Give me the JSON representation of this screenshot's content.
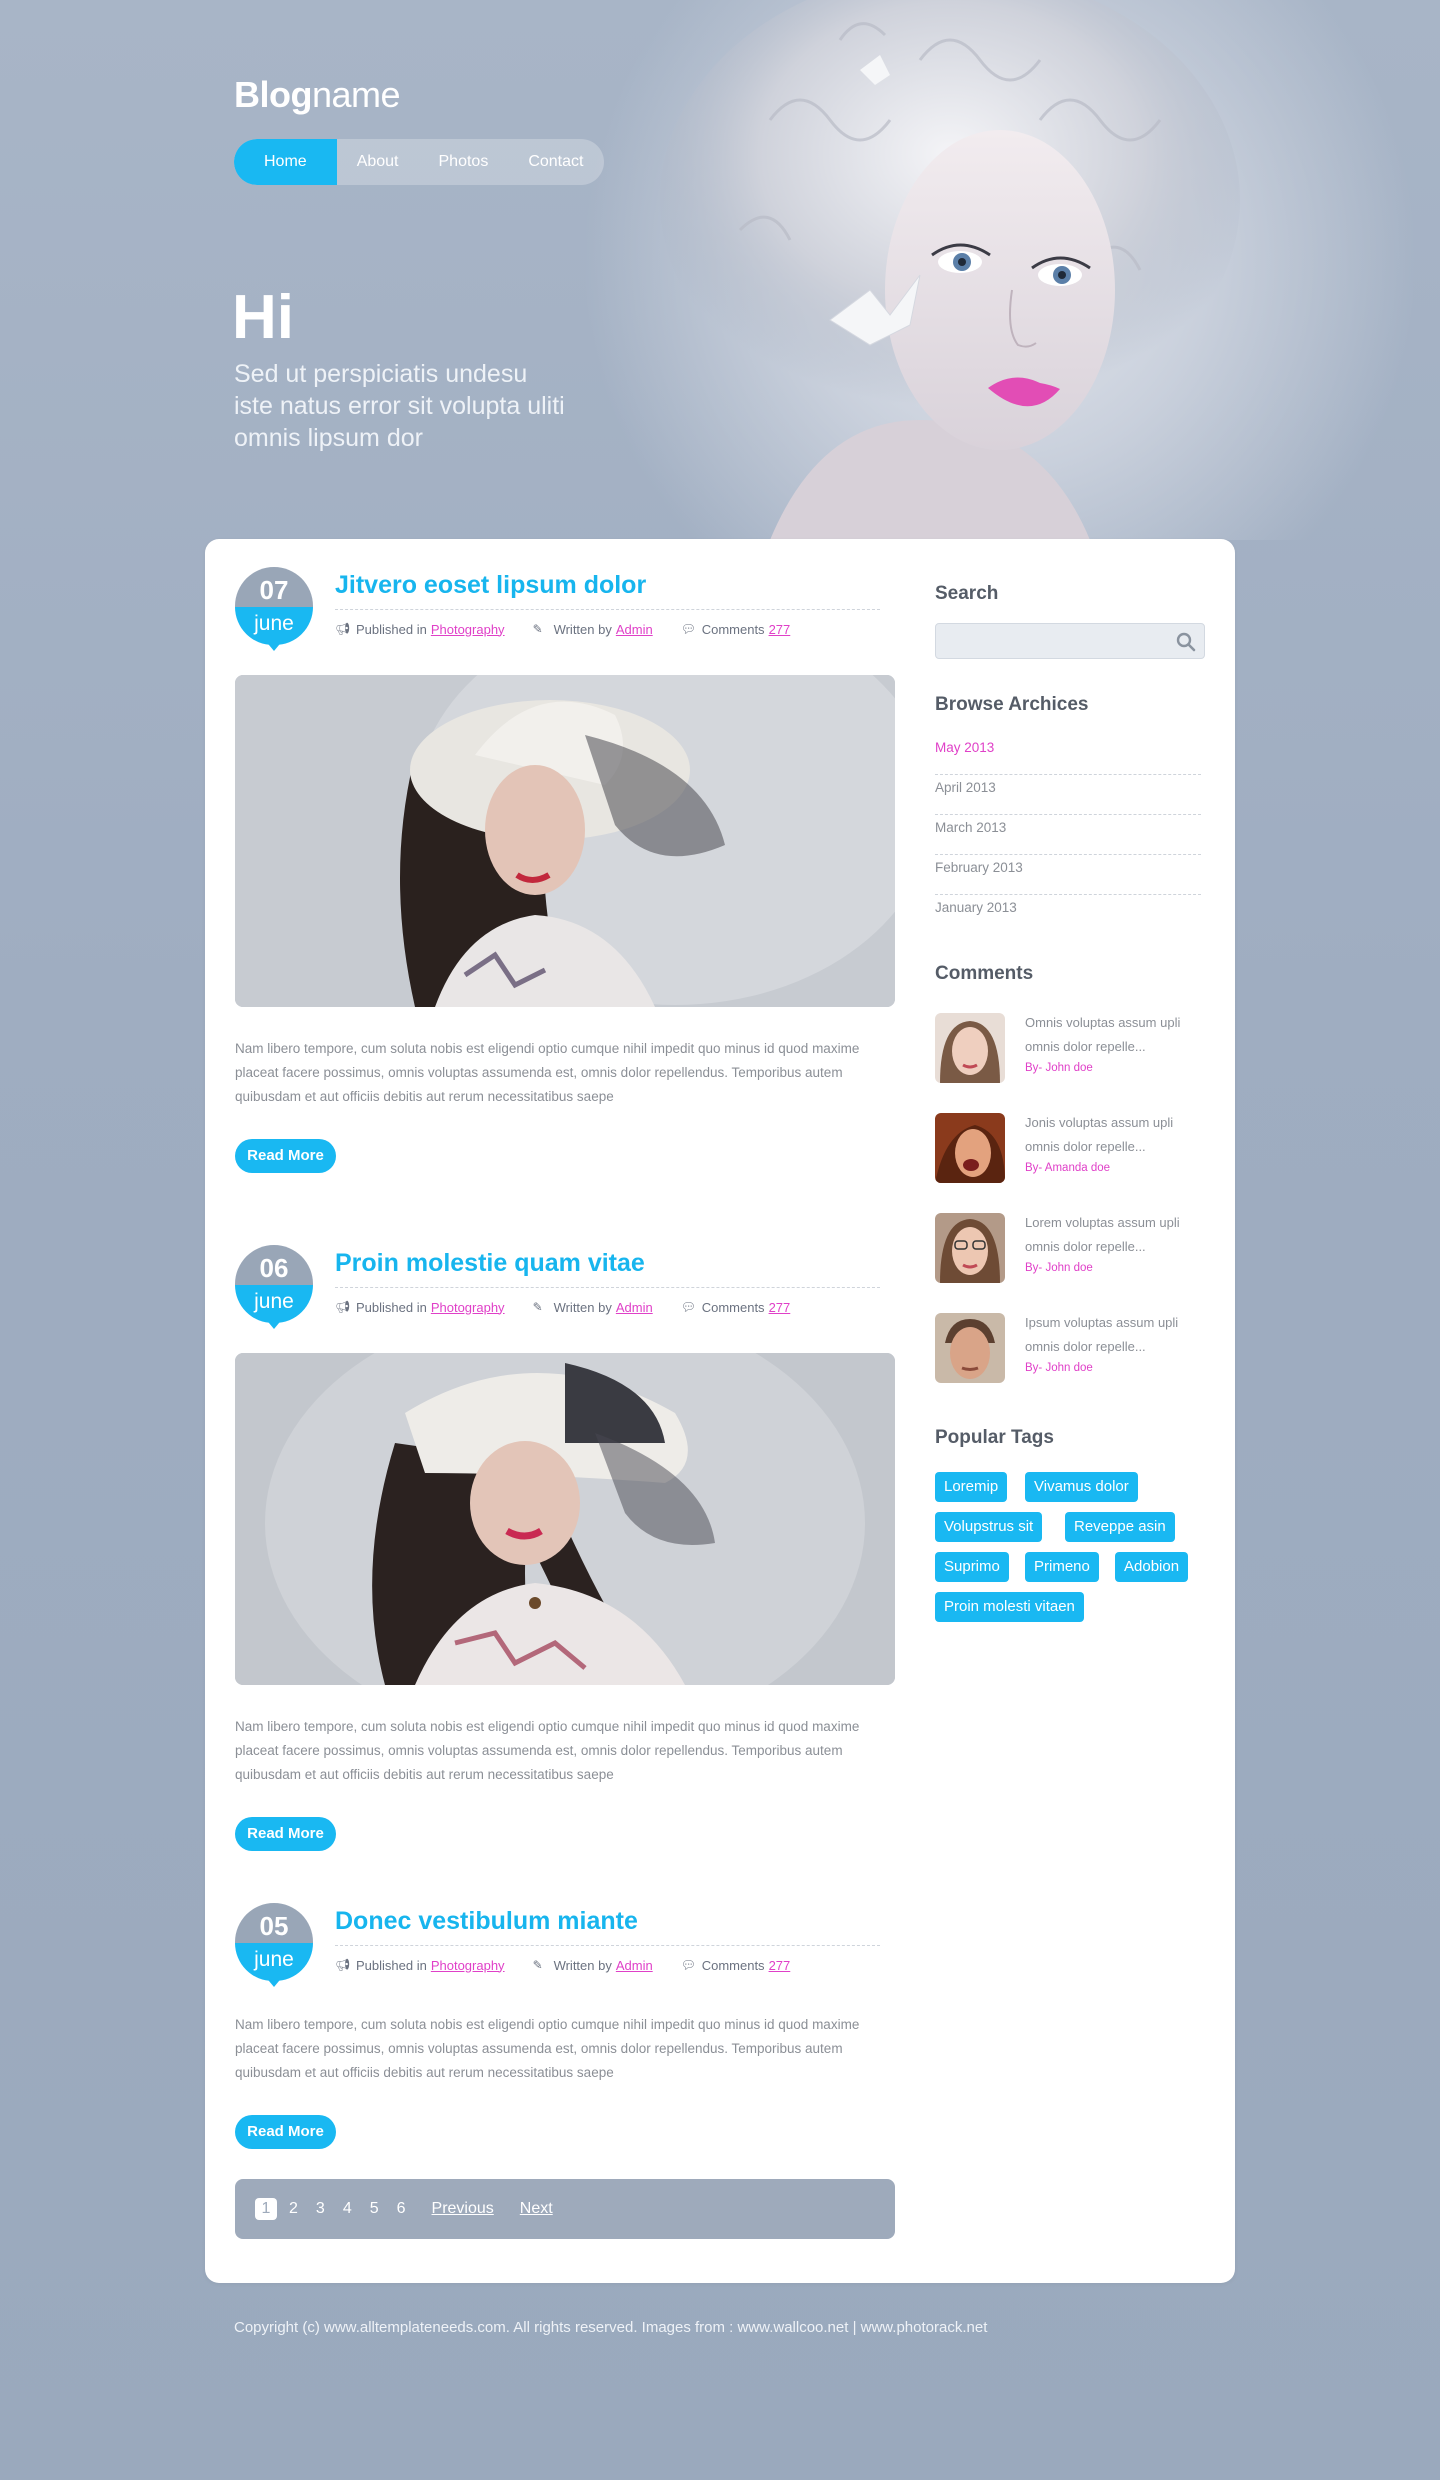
{
  "header": {
    "logo_bold": "Blog",
    "logo_light": "name",
    "nav": [
      "Home",
      "About",
      "Photos",
      "Contact"
    ],
    "hero_title": "Hi",
    "hero_lines": [
      "Sed ut perspiciatis undesu",
      "iste natus error sit volupta uliti",
      "omnis lipsum dor"
    ]
  },
  "posts": [
    {
      "day": "07",
      "month": "june",
      "title": "Jitvero eoset lipsum dolor",
      "published_label": "Published in",
      "category": "Photography",
      "written_label": "Written by",
      "author": "Admin",
      "comments_label": "Comments",
      "comments_count": "277",
      "excerpt": "Nam libero tempore, cum soluta nobis est eligendi optio cumque nihil impedit quo minus id quod maxime placeat facere possimus, omnis voluptas assumenda est, omnis dolor repellendus. Temporibus autem quibusdam et aut officiis debitis aut rerum necessitatibus saepe",
      "read_more": "Read More"
    },
    {
      "day": "06",
      "month": "june",
      "title": "Proin molestie quam vitae",
      "published_label": "Published in",
      "category": "Photography",
      "written_label": "Written by",
      "author": "Admin",
      "comments_label": "Comments",
      "comments_count": "277",
      "excerpt": "Nam libero tempore, cum soluta nobis est eligendi optio cumque nihil impedit quo minus id quod maxime placeat facere possimus, omnis voluptas assumenda est, omnis dolor repellendus. Temporibus autem quibusdam et aut officiis debitis aut rerum necessitatibus saepe",
      "read_more": "Read More"
    },
    {
      "day": "05",
      "month": "june",
      "title": "Donec vestibulum miante",
      "published_label": "Published in",
      "category": "Photography",
      "written_label": "Written by",
      "author": "Admin",
      "comments_label": "Comments",
      "comments_count": "277",
      "excerpt": "Nam libero tempore, cum soluta nobis est eligendi optio cumque nihil impedit quo minus id quod maxime placeat facere possimus, omnis voluptas assumenda est, omnis dolor repellendus. Temporibus autem quibusdam et aut officiis debitis aut rerum necessitatibus saepe",
      "read_more": "Read More"
    }
  ],
  "pagination": {
    "pages": [
      "1",
      "2",
      "3",
      "4",
      "5",
      "6"
    ],
    "current": "1",
    "previous": "Previous",
    "next": "Next"
  },
  "sidebar": {
    "search_title": "Search",
    "search_value": "",
    "archives_title": "Browse Archices",
    "archives": [
      "May 2013",
      "April 2013",
      "March 2013",
      "February 2013",
      "January 2013"
    ],
    "comments_title": "Comments",
    "comments": [
      {
        "line1": "Omnis voluptas assum upli",
        "line2": "omnis dolor repelle...",
        "by": "By- John doe"
      },
      {
        "line1": "Jonis voluptas assum upli",
        "line2": "omnis dolor repelle...",
        "by": "By- Amanda doe"
      },
      {
        "line1": "Lorem voluptas assum upli",
        "line2": "omnis dolor repelle...",
        "by": "By- John doe"
      },
      {
        "line1": "Ipsum voluptas assum upli",
        "line2": "omnis dolor repelle...",
        "by": "By- John doe"
      }
    ],
    "tags_title": "Popular Tags",
    "tags": [
      "Loremip",
      "Vivamus dolor",
      "Volupstrus sit",
      "Reveppe asin",
      "Suprimo",
      "Primeno",
      "Adobion",
      "Proin molesti vitaen"
    ]
  },
  "footer": {
    "copyright": "Copyright (c) www.alltemplateneeds.com. All rights reserved. Images from : www.wallcoo.net | www.photorack.net"
  },
  "colors": {
    "accent": "#19b8f2",
    "link": "#e040c8",
    "badge_grey": "#99a6b7",
    "page_bg": "#a8b5c7"
  }
}
